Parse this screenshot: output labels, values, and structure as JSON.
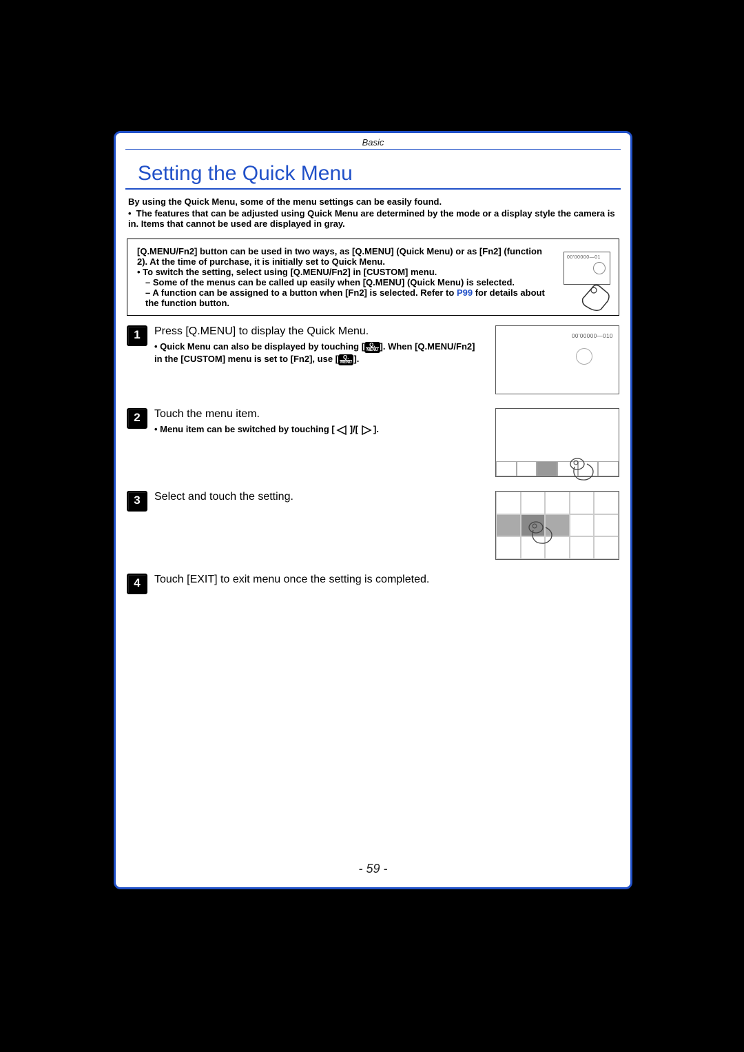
{
  "section_header": "Basic",
  "title": "Setting the Quick Menu",
  "intro_line1": "By using the Quick Menu, some of the menu settings can be easily found.",
  "intro_line2": "The features that can be adjusted using Quick Menu are determined by the mode or a display style the camera is in. Items that cannot be used are displayed in gray.",
  "note_box": {
    "line1": "[Q.MENU/Fn2] button can be used in two ways, as [Q.MENU] (Quick Menu) or as [Fn2] (function 2). At the time of purchase, it is initially set to Quick Menu.",
    "b1": "To switch the setting, select using [Q.MENU/Fn2] in [CUSTOM] menu.",
    "b2": "Some of the menus can be called up easily when [Q.MENU] (Quick Menu) is selected.",
    "b3a": "A function can be assigned to a button when [Fn2] is selected. Refer to ",
    "b3_link": "P99",
    "b3b": " for details about the function button.",
    "screen_text": "00'00000—01"
  },
  "steps": [
    {
      "num": "1",
      "text": "Press [Q.MENU] to display the Quick Menu.",
      "sub_a": "Quick Menu can also be displayed by touching [",
      "sub_b": "]. When [Q.MENU/Fn2] in the [CUSTOM] menu is set to [Fn2], use [",
      "sub_c": "].",
      "screen_text": "00'00000—010"
    },
    {
      "num": "2",
      "text": "Touch the menu item.",
      "sub_a": "Menu item can be switched by touching [",
      "sub_b": "]/[",
      "sub_c": "]."
    },
    {
      "num": "3",
      "text": "Select and touch the setting."
    },
    {
      "num": "4",
      "text": "Touch [EXIT] to exit menu once the setting is completed."
    }
  ],
  "page_number": "- 59 -"
}
